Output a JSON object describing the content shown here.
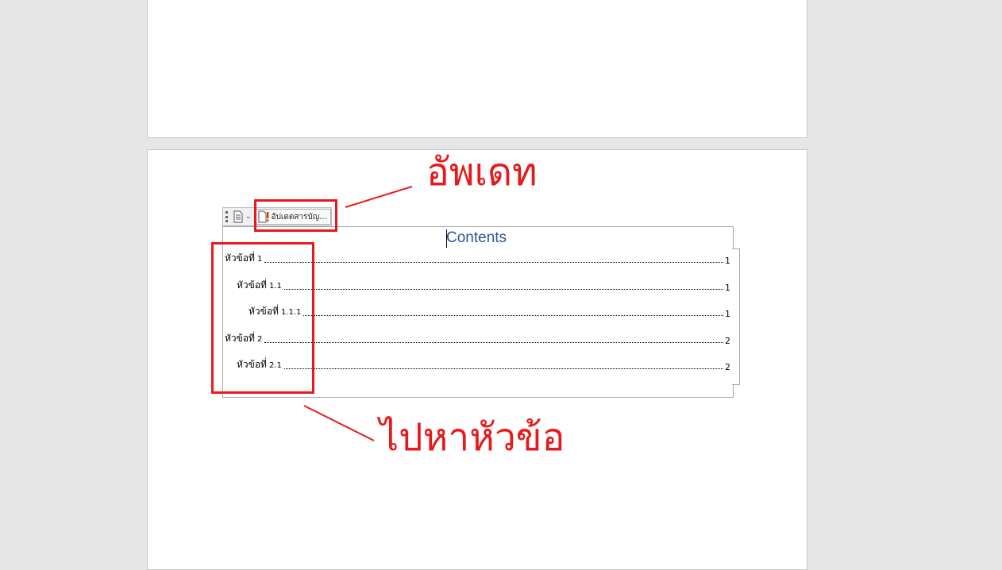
{
  "toolbar": {
    "update_button_label": "อัปเดตสารบัญ..."
  },
  "toc": {
    "heading": "Contents",
    "entries": [
      {
        "label": "หัวข้อที่",
        "num": "1",
        "page": "1"
      },
      {
        "label": "หัวข้อที่",
        "num": "1.1",
        "page": "1"
      },
      {
        "label": "หัวข้อที่",
        "num": "1.1.1",
        "page": "1"
      },
      {
        "label": "หัวข้อที่",
        "num": "2",
        "page": "2"
      },
      {
        "label": "หัวข้อที่",
        "num": "2.1",
        "page": "2"
      }
    ]
  },
  "annotations": {
    "update_note": "อัพเดท",
    "goto_note": "ไปหาหัวข้อ",
    "color": "#e8191c"
  },
  "colors": {
    "heading": "#2f5496",
    "workspace": "#e6e6e6"
  }
}
